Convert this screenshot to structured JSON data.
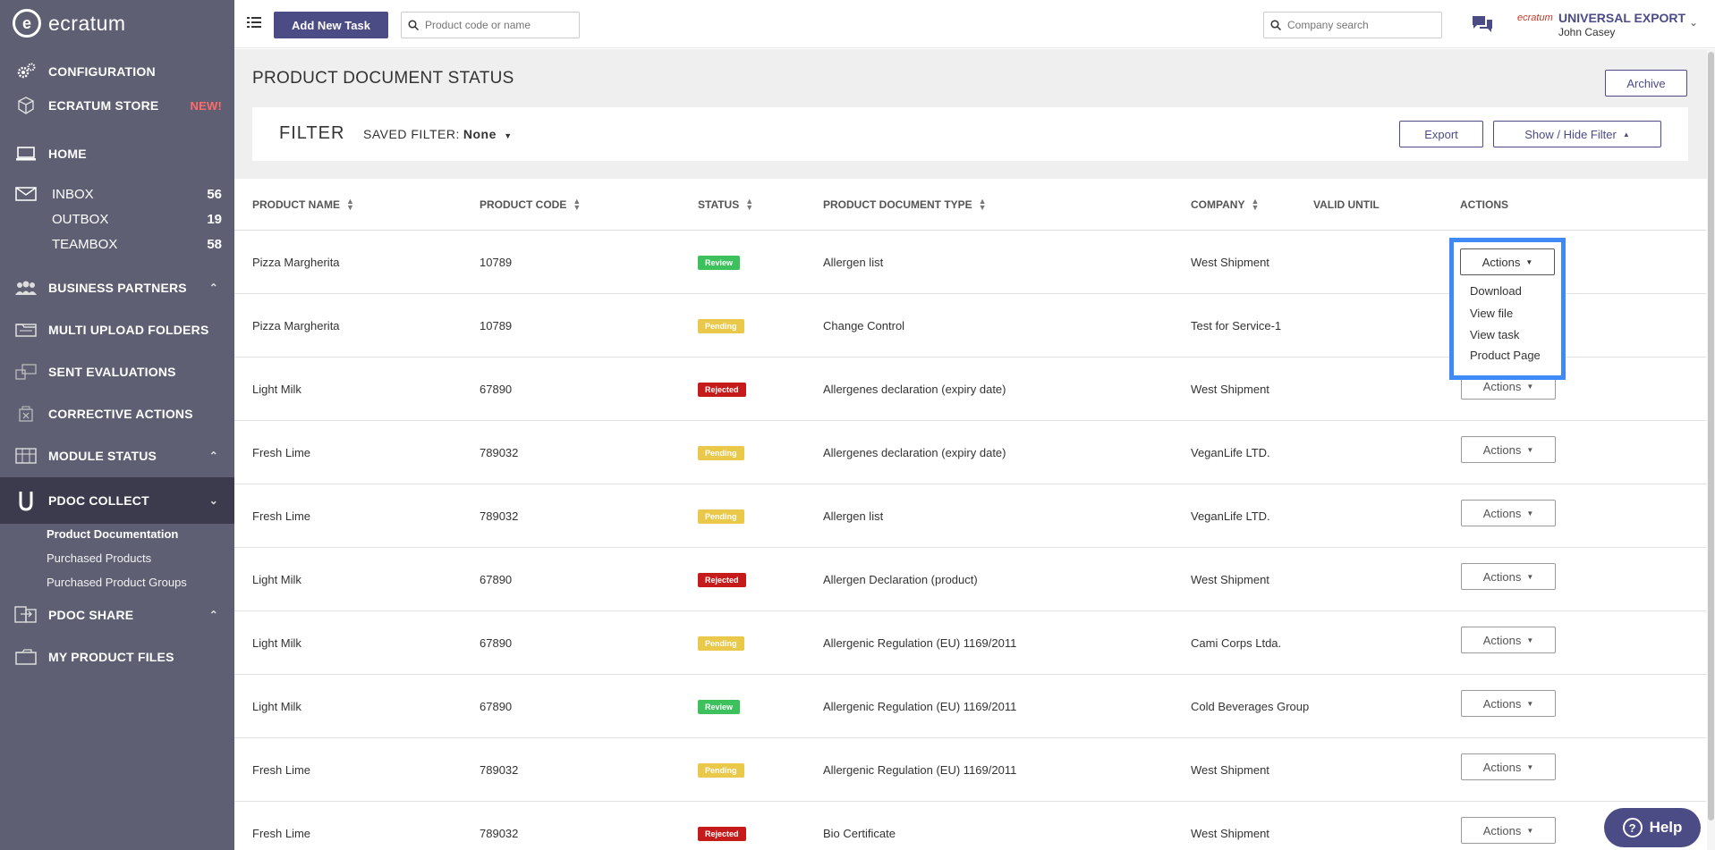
{
  "brand": {
    "logo_letter": "e",
    "name": "ecratum"
  },
  "sidebar": {
    "configuration": "CONFIGURATION",
    "store": "ECRATUM STORE",
    "store_badge": "NEW!",
    "home": "HOME",
    "inbox": {
      "label": "INBOX",
      "count": "56"
    },
    "outbox": {
      "label": "OUTBOX",
      "count": "19"
    },
    "teambox": {
      "label": "TEAMBOX",
      "count": "58"
    },
    "business_partners": "BUSINESS PARTNERS",
    "multi_upload": "MULTI UPLOAD FOLDERS",
    "sent_evaluations": "SENT EVALUATIONS",
    "corrective_actions": "CORRECTIVE ACTIONS",
    "module_status": "MODULE STATUS",
    "pdoc_collect": "PDOC COLLECT",
    "pdoc_collect_items": [
      "Product Documentation",
      "Purchased Products",
      "Purchased Product Groups"
    ],
    "pdoc_share": "PDOC SHARE",
    "my_product_files": "MY PRODUCT FILES"
  },
  "topbar": {
    "add_task": "Add New Task",
    "product_search_placeholder": "Product code or name",
    "company_search_placeholder": "Company search",
    "user_logo_text": "ecratum",
    "company": "UNIVERSAL EXPORT",
    "user": "John Casey"
  },
  "page": {
    "title": "PRODUCT DOCUMENT STATUS",
    "archive": "Archive",
    "filter_title": "FILTER",
    "saved_filter_label": "SAVED FILTER:",
    "saved_filter_value": "None",
    "export": "Export",
    "toggle_filter": "Show / Hide Filter"
  },
  "table": {
    "headers": {
      "product_name": "PRODUCT NAME",
      "product_code": "PRODUCT CODE",
      "status": "STATUS",
      "doc_type": "PRODUCT DOCUMENT TYPE",
      "company": "COMPANY",
      "valid_until": "VALID UNTIL",
      "actions": "ACTIONS"
    },
    "actions_label": "Actions",
    "rows": [
      {
        "name": "Pizza Margherita",
        "code": "10789",
        "status": "Review",
        "doc_type": "Allergen list",
        "company": "West Shipment",
        "valid_until": ""
      },
      {
        "name": "Pizza Margherita",
        "code": "10789",
        "status": "Pending",
        "doc_type": "Change Control",
        "company": "Test for Service-1",
        "valid_until": ""
      },
      {
        "name": "Light Milk",
        "code": "67890",
        "status": "Rejected",
        "doc_type": "Allergenes declaration (expiry date)",
        "company": "West Shipment",
        "valid_until": ""
      },
      {
        "name": "Fresh Lime",
        "code": "789032",
        "status": "Pending",
        "doc_type": "Allergenes declaration (expiry date)",
        "company": "VeganLife LTD.",
        "valid_until": ""
      },
      {
        "name": "Fresh Lime",
        "code": "789032",
        "status": "Pending",
        "doc_type": "Allergen list",
        "company": "VeganLife LTD.",
        "valid_until": ""
      },
      {
        "name": "Light Milk",
        "code": "67890",
        "status": "Rejected",
        "doc_type": "Allergen Declaration (product)",
        "company": "West Shipment",
        "valid_until": ""
      },
      {
        "name": "Light Milk",
        "code": "67890",
        "status": "Pending",
        "doc_type": "Allergenic Regulation (EU) 1169/2011",
        "company": "Cami Corps Ltda.",
        "valid_until": ""
      },
      {
        "name": "Light Milk",
        "code": "67890",
        "status": "Review",
        "doc_type": "Allergenic Regulation (EU) 1169/2011",
        "company": "Cold Beverages Group",
        "valid_until": ""
      },
      {
        "name": "Fresh Lime",
        "code": "789032",
        "status": "Pending",
        "doc_type": "Allergenic Regulation (EU) 1169/2011",
        "company": "West Shipment",
        "valid_until": ""
      },
      {
        "name": "Fresh Lime",
        "code": "789032",
        "status": "Rejected",
        "doc_type": "Bio Certificate",
        "company": "West Shipment",
        "valid_until": ""
      }
    ]
  },
  "dropdown": {
    "items": [
      "Download",
      "View file",
      "View task",
      "Product Page"
    ]
  },
  "help": {
    "label": "Help"
  },
  "colors": {
    "sidebar": "#5f5f73",
    "sidebar_active": "#3b3b4d",
    "accent": "#4b4c86",
    "review": "#3cc15c",
    "pending": "#e9c84a",
    "rejected": "#c61b1b",
    "highlight": "#3f8af7"
  }
}
